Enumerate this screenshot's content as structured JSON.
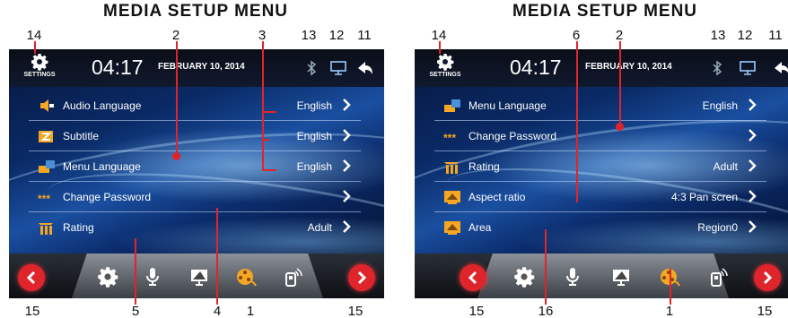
{
  "diagrams": [
    {
      "title": "MEDIA SETUP MENU",
      "status": {
        "settings_label": "SETTINGS",
        "time": "04:17",
        "date": "FEBRUARY 10, 2014"
      },
      "rows": [
        {
          "icon": "audio-language-icon",
          "label": "Audio  Language",
          "value": "English"
        },
        {
          "icon": "subtitle-icon",
          "label": "Subtitle",
          "value": "English"
        },
        {
          "icon": "menu-language-icon",
          "label": "Menu Language",
          "value": "English"
        },
        {
          "icon": "change-password-icon",
          "label": "Change Password",
          "value": ""
        },
        {
          "icon": "rating-icon",
          "label": "Rating",
          "value": "Adult"
        }
      ],
      "callouts_top": [
        "14",
        "2",
        "3",
        "13",
        "12",
        "11"
      ],
      "callouts_bottom": [
        "15",
        "5",
        "4",
        "1",
        "15"
      ]
    },
    {
      "title": "MEDIA SETUP MENU",
      "status": {
        "settings_label": "SETTINGS",
        "time": "04:17",
        "date": "FEBRUARY 10, 2014"
      },
      "rows": [
        {
          "icon": "menu-language-icon",
          "label": "Menu Language",
          "value": "English"
        },
        {
          "icon": "change-password-icon",
          "label": "Change Password",
          "value": ""
        },
        {
          "icon": "rating-icon",
          "label": "Rating",
          "value": "Adult"
        },
        {
          "icon": "aspect-ratio-icon",
          "label": "Aspect ratio",
          "value": "4:3 Pan scren"
        },
        {
          "icon": "area-icon",
          "label": "Area",
          "value": "Region0"
        }
      ],
      "callouts_top": [
        "14",
        "6",
        "2",
        "13",
        "12",
        "11"
      ],
      "callouts_bottom": [
        "15",
        "16",
        "1",
        "15"
      ]
    }
  ],
  "colors": {
    "accent": "#e0242b",
    "icon_orange": "#f5a623",
    "background": "#0a2a66"
  }
}
